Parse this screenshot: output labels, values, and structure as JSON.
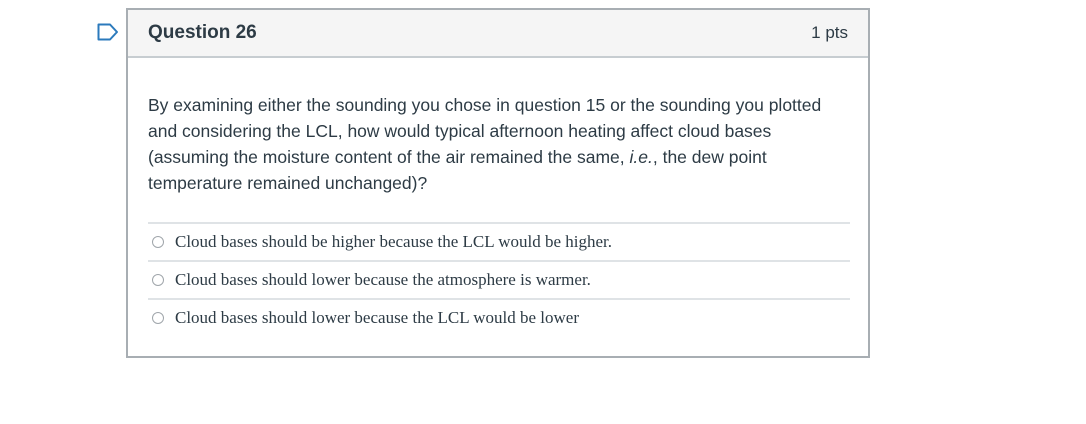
{
  "question": {
    "flag_icon": "bookmark-flag-icon",
    "title": "Question 26",
    "points": "1 pts",
    "text_part1": "By examining either the sounding you chose in question 15 or the sounding you plotted and considering the LCL, how would typical afternoon heating affect cloud bases (assuming the moisture content of the air remained the same, ",
    "text_italic": "i.e.",
    "text_part2": ", the dew point temperature remained unchanged)?",
    "answers": [
      {
        "label": "Cloud bases should be higher because the LCL would be higher."
      },
      {
        "label": "Cloud bases should lower because the atmosphere is warmer."
      },
      {
        "label": "Cloud bases should lower because the LCL would be lower"
      }
    ]
  },
  "colors": {
    "border": "#a8aeb3",
    "header_bg": "#f5f5f5",
    "text": "#2d3b45",
    "flag": "#2b7abc"
  }
}
